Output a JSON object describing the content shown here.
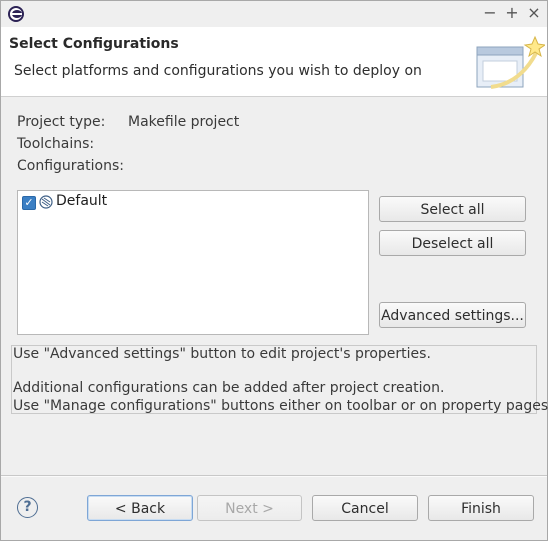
{
  "window": {
    "controls": {
      "minimize": "−",
      "maximize": "+",
      "close": "×"
    }
  },
  "header": {
    "title": "Select Configurations",
    "description": "Select platforms and configurations you wish to deploy on"
  },
  "fields": {
    "project_type_label": "Project type:",
    "project_type_value": "Makefile project",
    "toolchains_label": "Toolchains:",
    "configurations_label": "Configurations:"
  },
  "configurations": [
    {
      "label": "Default",
      "checked": true
    }
  ],
  "side_buttons": {
    "select_all": "Select all",
    "deselect_all": "Deselect all",
    "advanced": "Advanced settings..."
  },
  "info": {
    "line1": "Use \"Advanced settings\" button to edit project's properties.",
    "line2": "Additional configurations can be added after project creation.",
    "line3": "Use \"Manage configurations\" buttons either on toolbar or on property pages."
  },
  "footer": {
    "help_glyph": "?",
    "back": "< Back",
    "next": "Next >",
    "cancel": "Cancel",
    "finish": "Finish"
  },
  "icons": {
    "app": "eclipse-icon",
    "wizard": "wizard-banner-icon",
    "config": "configuration-icon",
    "help": "help-icon"
  },
  "colors": {
    "checkbox": "#3b7fc4",
    "default_button_border": "#7ea6d6"
  }
}
